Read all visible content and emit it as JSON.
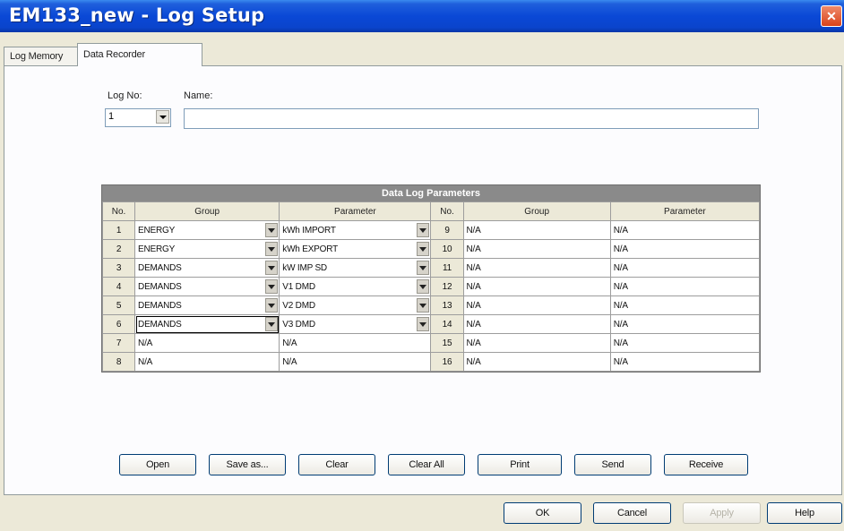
{
  "window": {
    "title": "EM133_new - Log Setup",
    "close_icon": "close-icon",
    "colors": {
      "titlebar": "#0a48d6",
      "close": "#d9431b",
      "face": "#ece9d8"
    }
  },
  "tabs": [
    {
      "label": "Log Memory",
      "active": false
    },
    {
      "label": "Data Recorder",
      "active": true
    }
  ],
  "log": {
    "log_no_label": "Log No:",
    "log_no_value": "1",
    "name_label": "Name:",
    "name_value": ""
  },
  "table": {
    "title": "Data Log Parameters",
    "headers": [
      "No.",
      "Group",
      "Parameter",
      "No.",
      "Group",
      "Parameter"
    ],
    "rows": [
      {
        "no": "1",
        "group": "ENERGY",
        "param": "kWh IMPORT",
        "no2": "9",
        "group2": "N/A",
        "param2": "N/A"
      },
      {
        "no": "2",
        "group": "ENERGY",
        "param": "kWh EXPORT",
        "no2": "10",
        "group2": "N/A",
        "param2": "N/A"
      },
      {
        "no": "3",
        "group": "DEMANDS",
        "param": "kW IMP SD",
        "no2": "11",
        "group2": "N/A",
        "param2": "N/A"
      },
      {
        "no": "4",
        "group": "DEMANDS",
        "param": "V1 DMD",
        "no2": "12",
        "group2": "N/A",
        "param2": "N/A"
      },
      {
        "no": "5",
        "group": "DEMANDS",
        "param": "V2 DMD",
        "no2": "13",
        "group2": "N/A",
        "param2": "N/A"
      },
      {
        "no": "6",
        "group": "DEMANDS",
        "param": "V3 DMD",
        "no2": "14",
        "group2": "N/A",
        "param2": "N/A"
      },
      {
        "no": "7",
        "group": "N/A",
        "param": "N/A",
        "no2": "15",
        "group2": "N/A",
        "param2": "N/A"
      },
      {
        "no": "8",
        "group": "N/A",
        "param": "N/A",
        "no2": "16",
        "group2": "N/A",
        "param2": "N/A"
      }
    ]
  },
  "panel_buttons": {
    "open": "Open",
    "save_as": "Save as...",
    "clear": "Clear",
    "clear_all": "Clear All",
    "print": "Print",
    "send": "Send",
    "receive": "Receive"
  },
  "dialog_buttons": {
    "ok": "OK",
    "cancel": "Cancel",
    "apply": "Apply",
    "help": "Help"
  }
}
